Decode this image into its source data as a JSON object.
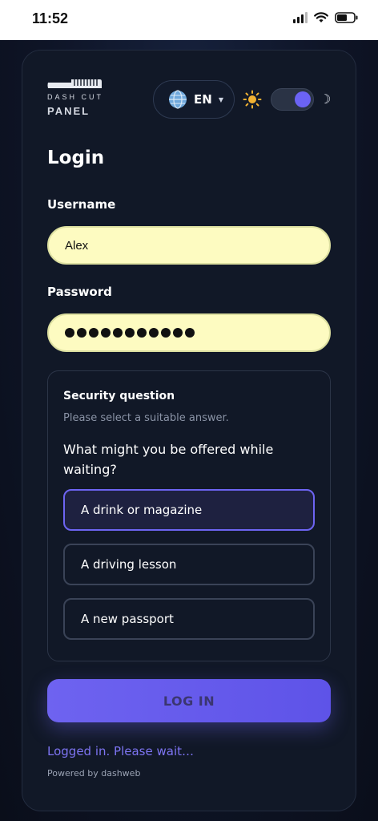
{
  "status_bar": {
    "time": "11:52"
  },
  "header": {
    "brand_top": "DASH CUT",
    "brand_bottom": "PANEL",
    "language": "EN",
    "theme_toggle": "dark"
  },
  "login": {
    "title": "Login",
    "username_label": "Username",
    "username_value": "Alex",
    "password_label": "Password",
    "password_mask_length": 11
  },
  "security": {
    "title": "Security question",
    "subtitle": "Please select a suitable answer.",
    "question": "What might you be offered while waiting?",
    "options": [
      {
        "label": "A drink or magazine",
        "selected": true
      },
      {
        "label": "A driving lesson",
        "selected": false
      },
      {
        "label": "A new passport",
        "selected": false
      }
    ]
  },
  "login_button": "LOG IN",
  "status_message": "Logged in. Please wait…",
  "footer": "Powered by dashweb",
  "colors": {
    "accent": "#6b63f4",
    "input_bg": "#fdfbc1",
    "card_bg": "#111827"
  }
}
